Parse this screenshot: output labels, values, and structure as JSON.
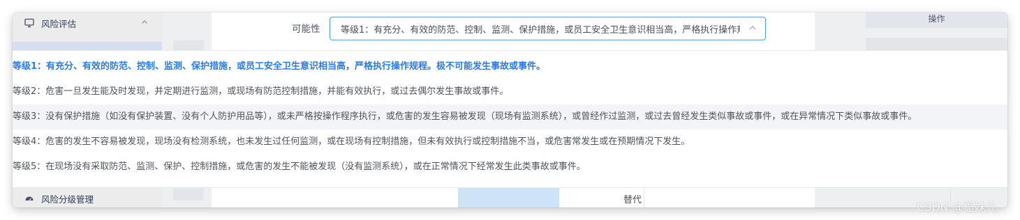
{
  "sidebar": {
    "items": [
      {
        "label": "风险评估",
        "icon": "monitor-icon"
      },
      {
        "label": "风险分级管理",
        "icon": "dashboard-icon"
      }
    ]
  },
  "table": {
    "operation_header": "操作",
    "replace_label": "替代"
  },
  "form": {
    "probability_label": "可能性",
    "probability_value": "等级1：有充分、有效的防范、控制、监测、保护措施，或员工安全卫生意识相当高，严格执行操作规程。极不可能发生事故或事件。"
  },
  "dropdown": {
    "options": [
      "等级1：有充分、有效的防范、控制、监测、保护措施，或员工安全卫生意识相当高，严格执行操作规程。极不可能发生事故或事件。",
      "等级2：危害一旦发生能及时发现，并定期进行监测，或现场有防范控制措施，并能有效执行，或过去偶尔发生事故或事件。",
      "等级3：没有保护措施（如没有保护装置、没有个人防护用品等），或未严格按操作程序执行，或危害的发生容易被发现（现场有监测系统），或曾经作过监测，或过去曾经发生类似事故或事件，或在异常情况下类似事故或事件。",
      "等级4：危害的发生不容易被发现，现场没有检测系统，也未发生过任何监测，或在现场有控制措施，但未有效执行或控制措施不当，或危害常发生或在预期情况下发生。",
      "等级5：在现场没有采取防范、监测、保护、控制措施，或危害的发生不能被发现（没有监测系统），或在正常情况下经常发生此类事故或事件。"
    ],
    "selected_index": 0,
    "hovered_index": 2
  },
  "watermark": "CSDN @栀妹儿",
  "colors": {
    "accent": "#409eff",
    "selected_text": "#2c7ae6",
    "hover_bg": "#f3f4f7"
  }
}
